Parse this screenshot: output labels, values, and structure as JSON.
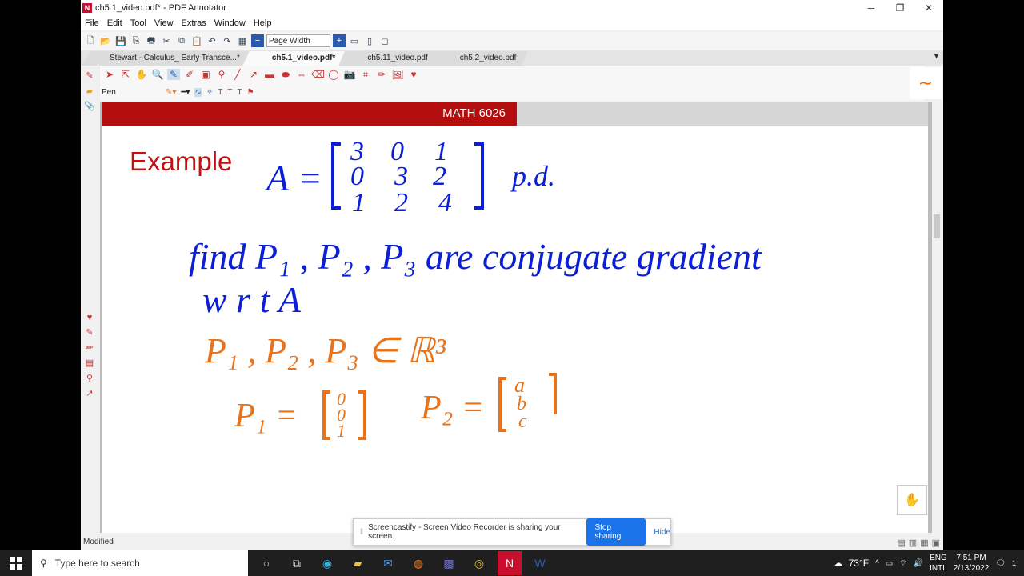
{
  "window": {
    "title": "ch5.1_video.pdf* - PDF Annotator",
    "min": "─",
    "max": "❐",
    "close": "✕"
  },
  "menu": [
    "File",
    "Edit",
    "Tool",
    "View",
    "Extras",
    "Window",
    "Help"
  ],
  "toolbar": {
    "zoom_value": "Page Width"
  },
  "tabs": [
    {
      "label": "Stewart - Calculus_ Early Transce...*",
      "active": false
    },
    {
      "label": "ch5.1_video.pdf*",
      "active": true
    },
    {
      "label": "ch5.11_video.pdf",
      "active": false
    },
    {
      "label": "ch5.2_video.pdf",
      "active": false
    }
  ],
  "tool_label": "Pen",
  "page": {
    "banner": "MATH 6026",
    "heading": "Example",
    "ink": {
      "line1": "A =",
      "matrix": [
        [
          "3",
          "0",
          "1"
        ],
        [
          "0",
          "3",
          "2"
        ],
        [
          "1",
          "2",
          "4"
        ]
      ],
      "pd": "p.d.",
      "line2": "find  P₁ , P₂ , P₃  are conjugate gradient",
      "line3": "w r t   A",
      "line4": "P₁ , P₂ , P₃ ∈ ℝ³",
      "p1": "P₁ =",
      "p1_vec": [
        "0",
        "0",
        "1"
      ],
      "p2": "P₂ =",
      "p2_vec": [
        "a",
        "b",
        "c"
      ]
    }
  },
  "colors": {
    "banner": "#b30d0d",
    "ink_blue": "#0a1fd6",
    "ink_orange": "#e8731a",
    "heading": "#c41010"
  },
  "status": {
    "text": "Modified"
  },
  "share_bar": {
    "message": "Screencastify - Screen Video Recorder is sharing your screen.",
    "stop_label": "Stop sharing",
    "hide_label": "Hide"
  },
  "taskbar": {
    "search_placeholder": "Type here to search",
    "weather": "73°F",
    "lang1": "ENG",
    "lang2": "INTL",
    "time": "7:51 PM",
    "date": "2/13/2022",
    "notifications": "1"
  }
}
